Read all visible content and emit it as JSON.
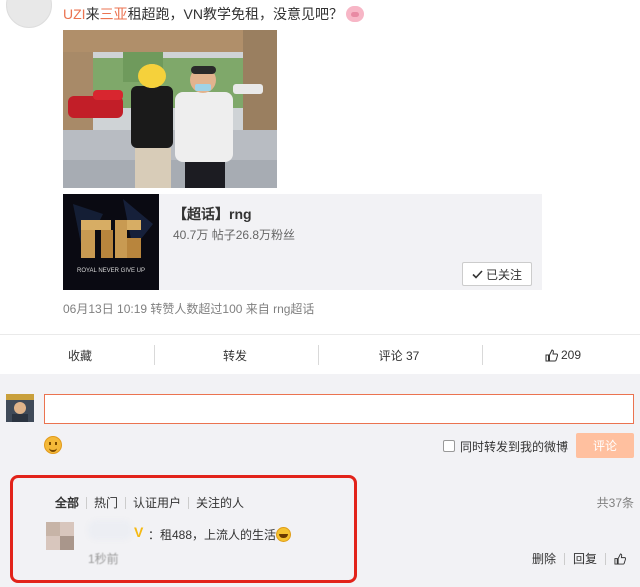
{
  "post": {
    "text_user": "UZI",
    "text_pre": "来",
    "text_link": "三亚",
    "text_post": "租超跑，VN教学免租，没意见吧？",
    "emoji_icon": "pig-emoji-icon"
  },
  "topic_card": {
    "logo_text": "ROYAL NEVER GIVE UP",
    "title": "【超话】rng",
    "stats": "40.7万 帖子26.8万粉丝",
    "follow_label": "已关注"
  },
  "meta": {
    "text": "06月13日 10:19 转赞人数超过100  来自 rng超话"
  },
  "actions": {
    "favorite": "收藏",
    "repost": "转发",
    "comment": "评论 37",
    "like": "209"
  },
  "comment_box": {
    "input_value": "",
    "repost_checkbox_label": "同时转发到我的微博",
    "submit_label": "评论"
  },
  "comment_tabs": {
    "all": "全部",
    "hot": "热门",
    "verified": "认证用户",
    "following": "关注的人",
    "total": "共37条"
  },
  "comments": [
    {
      "text": "：租488，上流人的生活",
      "time": "1秒前",
      "delete": "删除",
      "reply": "回复"
    }
  ],
  "colors": {
    "accent": "#eb7350",
    "submit_disabled": "#ffc09f",
    "comment_bg": "#f2f2f5",
    "highlight": "#e2231a",
    "vip": "#f5b913"
  }
}
